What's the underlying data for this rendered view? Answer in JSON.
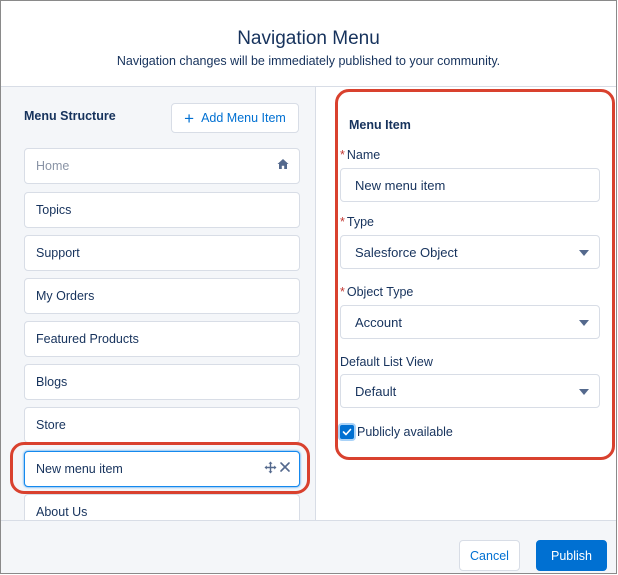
{
  "header": {
    "title": "Navigation Menu",
    "subtitle": "Navigation changes will be immediately published to your community."
  },
  "menu_structure": {
    "heading": "Menu Structure",
    "add_button_label": "Add Menu Item",
    "items": [
      {
        "label": "Home",
        "icon": "home-icon"
      },
      {
        "label": "Topics"
      },
      {
        "label": "Support"
      },
      {
        "label": "My Orders"
      },
      {
        "label": "Featured Products"
      },
      {
        "label": "Blogs"
      },
      {
        "label": "Store"
      },
      {
        "label": "New menu item",
        "selected": true,
        "icons": [
          "move-icon",
          "close-icon"
        ]
      },
      {
        "label": "About Us"
      }
    ]
  },
  "menu_item": {
    "heading": "Menu Item",
    "required_marker": "*",
    "name_label": "Name",
    "name_value": "New menu item",
    "type_label": "Type",
    "type_value": "Salesforce Object",
    "object_type_label": "Object Type",
    "object_type_value": "Account",
    "default_list_view_label": "Default List View",
    "default_list_view_value": "Default",
    "publicly_available_label": "Publicly available",
    "publicly_available_checked": true
  },
  "footer": {
    "cancel_label": "Cancel",
    "publish_label": "Publish"
  },
  "colors": {
    "brand": "#0070d2",
    "highlight": "#d9412e",
    "required": "#c23934"
  }
}
